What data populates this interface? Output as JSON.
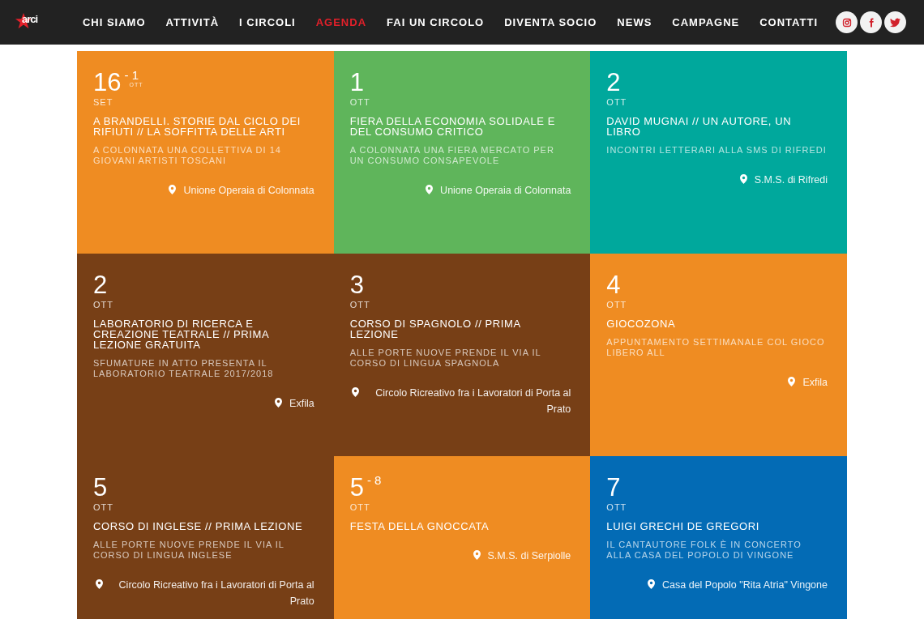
{
  "nav": {
    "logo": "arci",
    "items": [
      {
        "label": "CHI SIAMO",
        "selected": false
      },
      {
        "label": "ATTIVITÀ",
        "selected": false
      },
      {
        "label": "I CIRCOLI",
        "selected": false
      },
      {
        "label": "AGENDA",
        "selected": true
      },
      {
        "label": "FAI UN CIRCOLO",
        "selected": false
      },
      {
        "label": "DIVENTA SOCIO",
        "selected": false
      },
      {
        "label": "NEWS",
        "selected": false
      },
      {
        "label": "CAMPAGNE",
        "selected": false
      },
      {
        "label": "CONTATTI",
        "selected": false
      }
    ]
  },
  "events": [
    {
      "day": "16",
      "month": "SET",
      "end_day": "- 1",
      "end_month": "OTT",
      "title": "A BRANDELLI. STORIE DAL CICLO DEI RIFIUTI // LA SOFFITTA DELLE ARTI",
      "subtitle": "A COLONNATA UNA COLLETTIVA DI 14 GIOVANI ARTISTI TOSCANI",
      "place": "Unione Operaia di Colonnata",
      "color": "#ef8c22"
    },
    {
      "day": "1",
      "month": "OTT",
      "title": "FIERA DELLA ECONOMIA SOLIDALE E DEL CONSUMO CRITICO",
      "subtitle": "A COLONNATA UNA FIERA MERCATO PER UN CONSUMO CONSAPEVOLE",
      "place": "Unione Operaia di Colonnata",
      "color": "#5fb55b"
    },
    {
      "day": "2",
      "month": "OTT",
      "title": "DAVID MUGNAI // UN AUTORE, UN LIBRO",
      "subtitle": "INCONTRI LETTERARI ALLA SMS DI RIFREDI",
      "place": "S.M.S. di Rifredi",
      "color": "#00a89c"
    },
    {
      "day": "2",
      "month": "OTT",
      "title": "LABORATORIO DI RICERCA E CREAZIONE TEATRALE // PRIMA LEZIONE GRATUITA",
      "subtitle": "SFUMATURE IN ATTO PRESENTA IL LABORATORIO TEATRALE 2017/2018",
      "place": "Exfila",
      "color": "#773f16"
    },
    {
      "day": "3",
      "month": "OTT",
      "title": "CORSO DI SPAGNOLO // PRIMA LEZIONE",
      "subtitle": "ALLE PORTE NUOVE PRENDE IL VIA IL CORSO DI LINGUA SPAGNOLA",
      "place": "Circolo Ricreativo fra i Lavoratori di Porta al Prato",
      "color": "#773f16"
    },
    {
      "day": "4",
      "month": "OTT",
      "title": "GIOCOZONA",
      "subtitle": "APPUNTAMENTO SETTIMANALE COL GIOCO LIBERO ALL",
      "place": "Exfila",
      "color": "#ef8c22"
    },
    {
      "day": "5",
      "month": "OTT",
      "title": "CORSO DI INGLESE // PRIMA LEZIONE",
      "subtitle": "ALLE PORTE NUOVE PRENDE IL VIA IL CORSO DI LINGUA INGLESE",
      "place": "Circolo Ricreativo fra i Lavoratori di Porta al Prato",
      "color": "#773f16"
    },
    {
      "day": "5",
      "month": "OTT",
      "end_day": "- 8",
      "title": "FESTA DELLA GNOCCATA",
      "place": "S.M.S. di Serpiolle",
      "color": "#ef8c22"
    },
    {
      "day": "7",
      "month": "OTT",
      "title": "LUIGI GRECHI DE GREGORI",
      "subtitle": "IL CANTAUTORE FOLK È IN CONCERTO ALLA CASA DEL POPOLO DI VINGONE",
      "place": "Casa del Popolo \"Rita Atria\" Vingone",
      "color": "#036bb5"
    }
  ]
}
